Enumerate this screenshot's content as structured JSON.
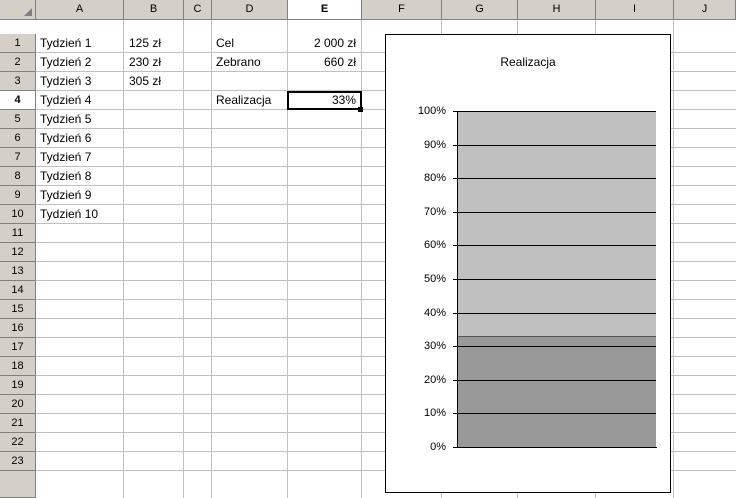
{
  "columns": [
    "A",
    "B",
    "C",
    "D",
    "E",
    "F",
    "G",
    "H",
    "I",
    "J"
  ],
  "rows": [
    "1",
    "2",
    "3",
    "4",
    "5",
    "6",
    "7",
    "8",
    "9",
    "10",
    "11",
    "12",
    "13",
    "14",
    "15",
    "16",
    "17",
    "18",
    "19",
    "20",
    "21",
    "22",
    "23"
  ],
  "cells": {
    "A1": "Tydzień 1",
    "A2": "Tydzień 2",
    "A3": "Tydzień 3",
    "A4": "Tydzień 4",
    "A5": "Tydzień 5",
    "A6": "Tydzień 6",
    "A7": "Tydzień 7",
    "A8": "Tydzień 8",
    "A9": "Tydzień 9",
    "A10": "Tydzień 10",
    "B1": "125 zł",
    "B2": "230 zł",
    "B3": "305 zł",
    "D1": "Cel",
    "D2": "Zebrano",
    "D4": "Realizacja",
    "E1": "2 000 zł",
    "E2": "660 zł",
    "E4": "33%"
  },
  "active_cell": "E4",
  "chart_data": {
    "type": "bar",
    "title": "Realizacja",
    "categories": [
      ""
    ],
    "values": [
      0.33
    ],
    "ylim": [
      0,
      1
    ],
    "yticks": [
      "0%",
      "10%",
      "20%",
      "30%",
      "40%",
      "50%",
      "60%",
      "70%",
      "80%",
      "90%",
      "100%"
    ],
    "grid": true,
    "legend": "none",
    "colors": {
      "bar": "#999999",
      "plot_background": "#c0c0c0"
    }
  }
}
